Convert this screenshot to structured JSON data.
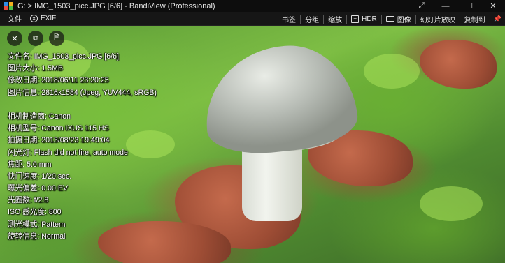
{
  "window": {
    "title": "G: > IMG_1503_picc.JPG [6/6] - BandiView (Professional)",
    "controls": [
      {
        "name": "fullscreen-button",
        "icon": "expand-icon",
        "glyph": "⤢"
      },
      {
        "name": "minimize-button",
        "icon": "minimize-icon",
        "glyph": "—"
      },
      {
        "name": "maximize-button",
        "icon": "maximize-icon",
        "glyph": "☐"
      },
      {
        "name": "close-button",
        "icon": "close-icon",
        "glyph": "✕"
      }
    ]
  },
  "toolbar": {
    "file_label": "文件",
    "exif_label": "EXIF",
    "bookmark_label": "书签",
    "group_label": "分组",
    "zoom_label": "缩放",
    "hdr_label": "HDR",
    "image_label": "图像",
    "slideshow_label": "幻灯片放映",
    "copy_to_label": "复制到",
    "pin_glyph": "📌"
  },
  "overlay": {
    "close_glyph": "✕",
    "copy_glyph": "⧉",
    "info_glyph": "🗎"
  },
  "info": {
    "file_name": "文件名: IMG_1503_picc.JPG [6/6]",
    "file_size": "图片大小: 1.5MB",
    "modified": "修改日期: 2018/06/11 23:20:25",
    "image_info": "图片信息: 2816x1584 (Jpeg, YUV444, sRGB)",
    "camera_maker": "相机制造商: Canon",
    "camera_model": "相机型号: Canon IXUS 115 HS",
    "date_taken": "拍摄日期: 2013/08/23 19:49:04",
    "flash": "闪光灯: Flash did not fire, auto mode",
    "focal_length": "焦距: 5.0 mm",
    "shutter": "快门速度: 1/20 sec.",
    "exposure_bias": "曝光偏差: 0.00 EV",
    "aperture": "光圈数: f/2.8",
    "iso": "ISO 感光度: 800",
    "metering": "测光模式: Pattern",
    "orientation": "旋转信息: Normal"
  },
  "colors": {
    "titlebar_bg": "#0d0d0d",
    "toolbar_bg": "#161616"
  }
}
